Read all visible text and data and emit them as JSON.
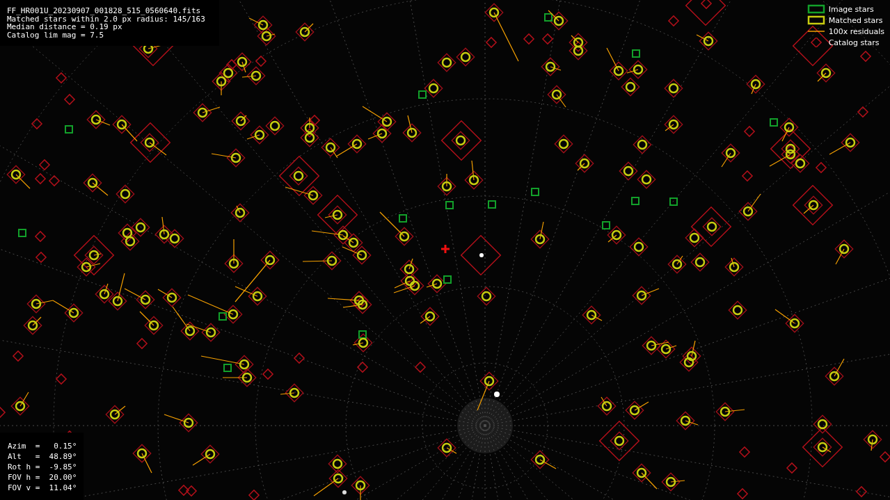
{
  "file_info": {
    "lines": [
      "FF_HR001U_20230907_001828_515_0560640.fits",
      "Matched stars within 2.0 px radius: 145/163",
      "Median distance = 0.19 px",
      "Catalog lim mag = 7.5"
    ]
  },
  "legend": [
    {
      "kind": "image",
      "label": "Image stars"
    },
    {
      "kind": "matched",
      "label": "Matched stars"
    },
    {
      "kind": "residual",
      "label": "100x residuals"
    },
    {
      "kind": "catalog",
      "label": "Catalog stars"
    }
  ],
  "pointing": {
    "lines": [
      "Azim  =   0.15°",
      "Alt   =  48.89°",
      "Rot h =  -9.85°",
      "FOV h =  20.00°",
      "FOV v =  11.04°"
    ]
  }
}
